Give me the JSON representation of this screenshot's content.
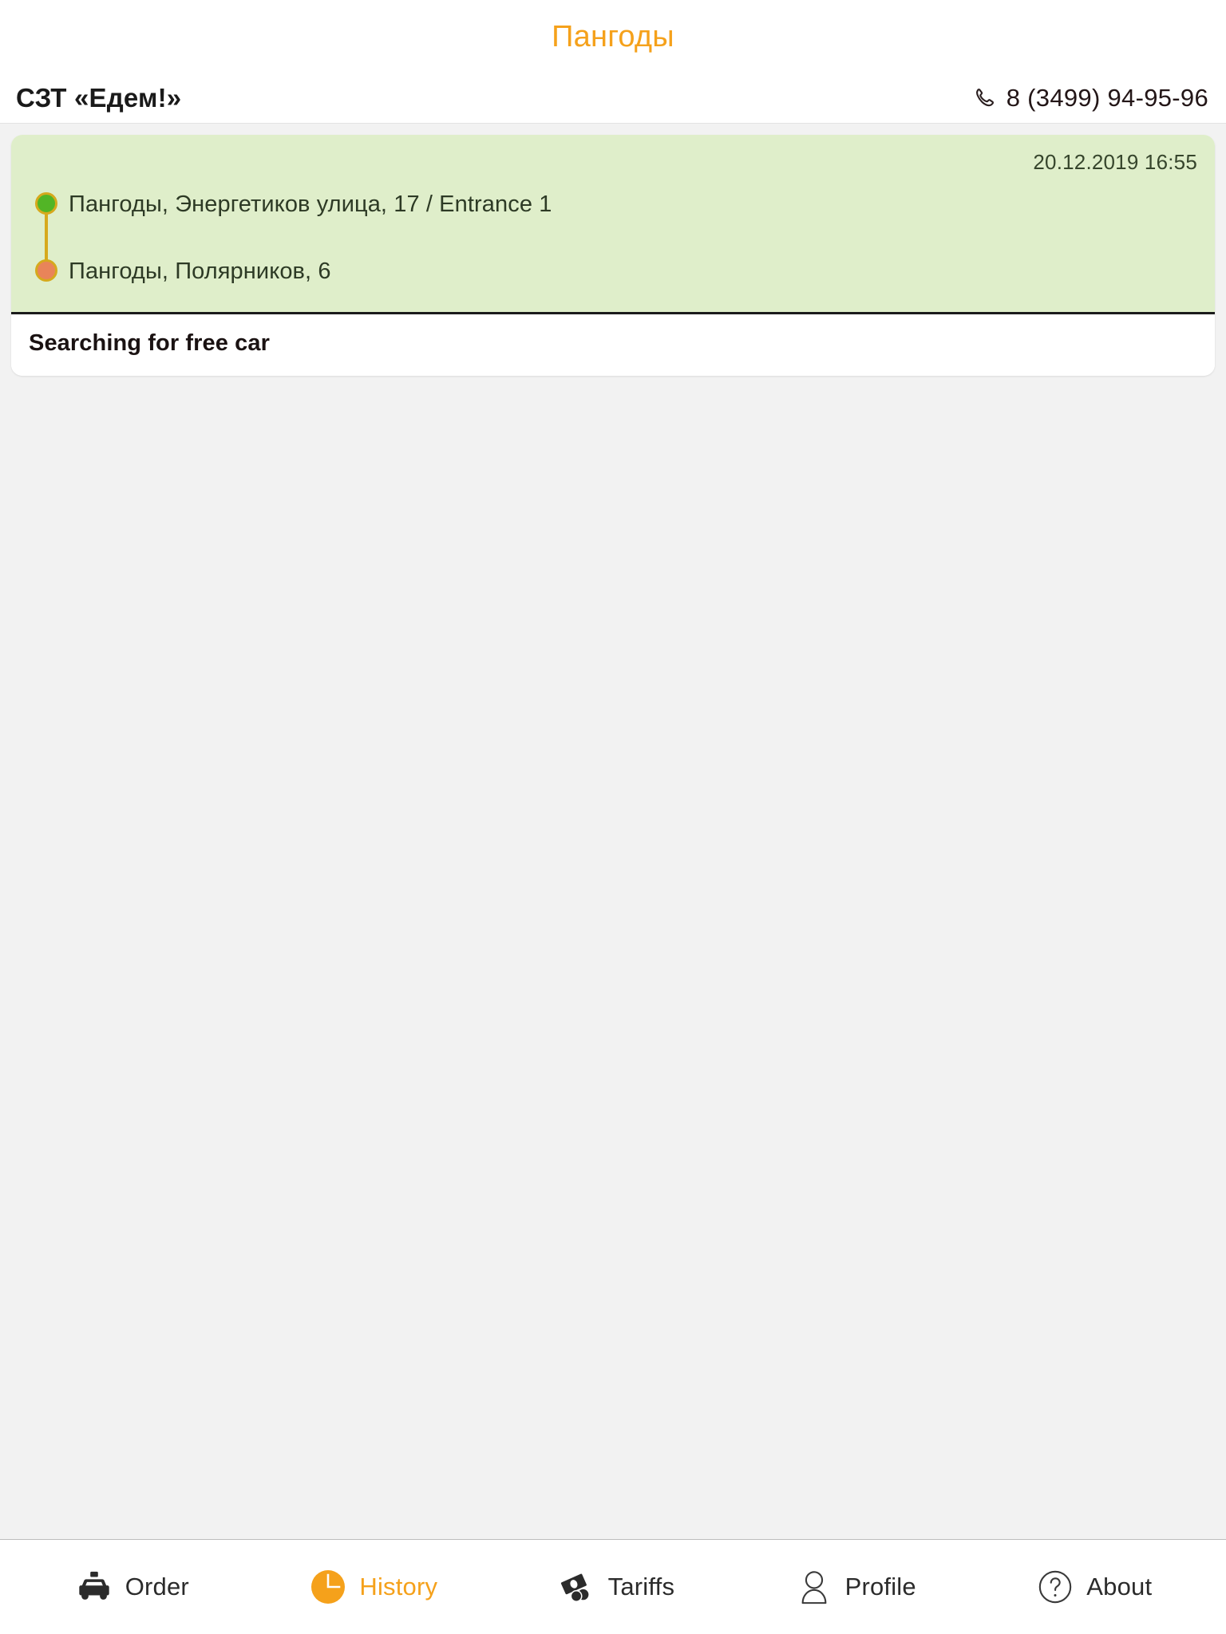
{
  "header": {
    "city": "Пангоды",
    "brand": "СЗТ «Едем!»",
    "phone": "8 (3499) 94-95-96",
    "phone_icon": "phone-icon"
  },
  "colors": {
    "accent": "#f5a11b",
    "card_green": "#dfeeca",
    "pickup_dot": "#52b526",
    "dropoff_dot": "#e98459",
    "route_line": "#d6a91d",
    "page_background": "#f2f2f2"
  },
  "order": {
    "timestamp": "20.12.2019 16:55",
    "pickup": "Пангоды, Энергетиков улица, 17 / Entrance 1",
    "dropoff": "Пангоды, Полярников, 6",
    "status": "Searching for free car"
  },
  "nav": {
    "items": [
      {
        "label": "Order",
        "icon": "taxi-icon",
        "active": false
      },
      {
        "label": "History",
        "icon": "clock-icon",
        "active": true
      },
      {
        "label": "Tariffs",
        "icon": "money-icon",
        "active": false
      },
      {
        "label": "Profile",
        "icon": "person-icon",
        "active": false
      },
      {
        "label": "About",
        "icon": "question-icon",
        "active": false
      }
    ]
  }
}
